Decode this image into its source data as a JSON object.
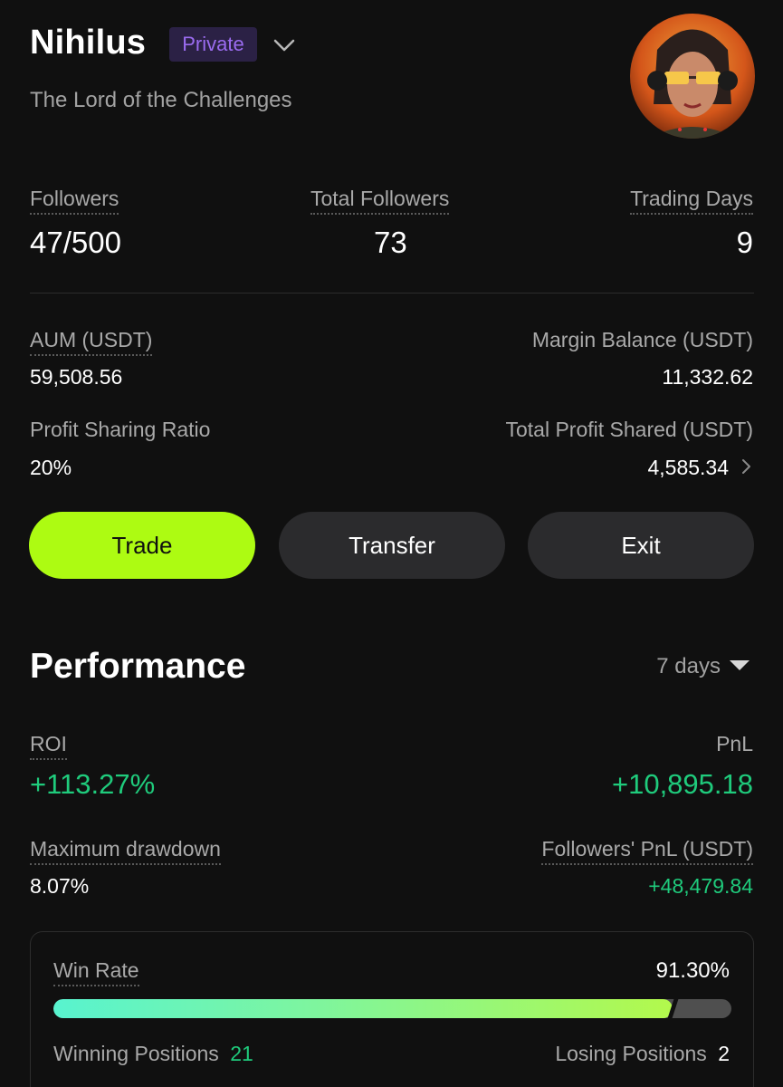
{
  "profile": {
    "name": "Nihilus",
    "visibility_badge": "Private",
    "tagline": "The Lord of the Challenges"
  },
  "stats": {
    "followers": {
      "label": "Followers",
      "value": "47/500"
    },
    "total_followers": {
      "label": "Total Followers",
      "value": "73"
    },
    "trading_days": {
      "label": "Trading Days",
      "value": "9"
    }
  },
  "account": {
    "aum": {
      "label": "AUM (USDT)",
      "value": "59,508.56"
    },
    "margin_balance": {
      "label": "Margin Balance (USDT)",
      "value": "11,332.62"
    },
    "profit_sharing_ratio": {
      "label": "Profit Sharing Ratio",
      "value": "20%"
    },
    "total_profit_shared": {
      "label": "Total Profit Shared (USDT)",
      "value": "4,585.34"
    }
  },
  "actions": {
    "trade": "Trade",
    "transfer": "Transfer",
    "exit": "Exit"
  },
  "performance": {
    "title": "Performance",
    "period": "7 days",
    "roi": {
      "label": "ROI",
      "value": "+113.27%"
    },
    "pnl": {
      "label": "PnL",
      "value": "+10,895.18"
    },
    "max_drawdown": {
      "label": "Maximum drawdown",
      "value": "8.07%"
    },
    "followers_pnl": {
      "label": "Followers' PnL (USDT)",
      "value": "+48,479.84"
    },
    "win_rate": {
      "label": "Win Rate",
      "value": "91.30%",
      "fraction": 0.913,
      "winning_label": "Winning Positions",
      "winning_count": "21",
      "losing_label": "Losing Positions",
      "losing_count": "2"
    }
  },
  "colors": {
    "background": "#101010",
    "accent_lime": "#adfb12",
    "badge_purple": "#9b6cf0",
    "positive_green": "#1fcb7c",
    "secondary_button": "#2b2b2d"
  },
  "icons": {
    "dropdown": "chevron-down-icon",
    "profit_detail": "chevron-right-icon",
    "period_caret": "caret-down-icon"
  }
}
